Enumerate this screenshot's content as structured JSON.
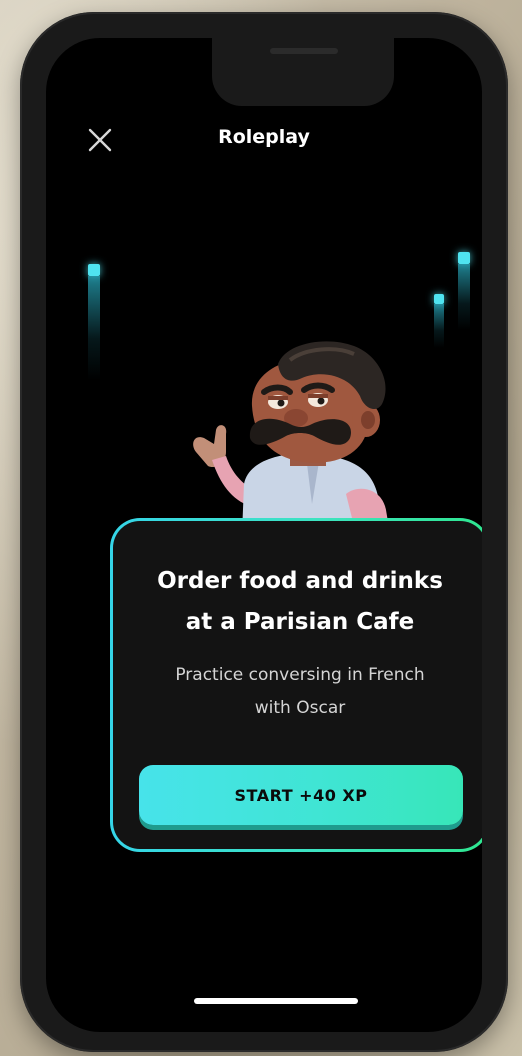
{
  "header": {
    "title": "Roleplay",
    "close_icon": "close-icon"
  },
  "scene": {
    "character_icon": "waiter-character-oscar",
    "audio_levels": [
      0.9,
      0.35,
      0.55
    ],
    "accent_color": "#4fe3f0"
  },
  "card": {
    "title_line1": "Order food and drinks",
    "title_line2": "at a Parisian Cafe",
    "subtitle_line1": "Practice conversing in French",
    "subtitle_line2": "with Oscar",
    "start_label": "START +40 XP",
    "border_gradient": [
      "#35d5e8",
      "#2ee68f"
    ]
  }
}
